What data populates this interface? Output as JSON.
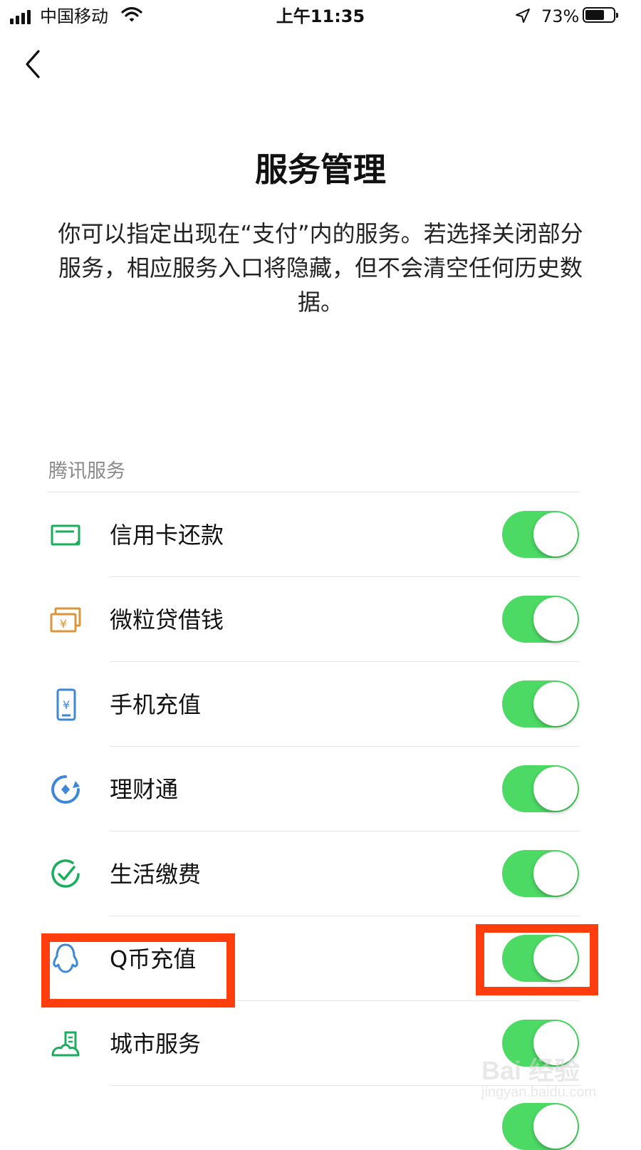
{
  "status_bar": {
    "carrier": "中国移动",
    "time": "上午11:35",
    "battery_percent": "73%",
    "battery_level": 0.73,
    "icons": [
      "signal-icon",
      "wifi-icon",
      "location-arrow-icon",
      "battery-icon"
    ]
  },
  "nav": {
    "back_icon": "chevron-left-icon"
  },
  "page": {
    "title": "服务管理",
    "description": "你可以指定出现在“支付”内的服务。若选择关闭部分服务，相应服务入口将隐藏，但不会清空任何历史数据。"
  },
  "section": {
    "label": "腾讯服务",
    "items": [
      {
        "label": "信用卡还款",
        "icon": "credit-card-icon",
        "enabled": true,
        "color": "#1aad5c"
      },
      {
        "label": "微粒贷借钱",
        "icon": "yuan-notes-icon",
        "enabled": true,
        "color": "#d9963a"
      },
      {
        "label": "手机充值",
        "icon": "phone-yuan-icon",
        "enabled": true,
        "color": "#3e87d6"
      },
      {
        "label": "理财通",
        "icon": "licaitong-icon",
        "enabled": true,
        "color": "#3e87d6"
      },
      {
        "label": "生活缴费",
        "icon": "check-circle-icon",
        "enabled": true,
        "color": "#1aad5c"
      },
      {
        "label": "Q币充值",
        "icon": "qq-penguin-icon",
        "enabled": true,
        "color": "#3e87d6"
      },
      {
        "label": "城市服务",
        "icon": "city-icon",
        "enabled": true,
        "color": "#1aad5c"
      }
    ]
  },
  "colors": {
    "toggle_on": "#4cd964",
    "highlight": "#ff3d0d",
    "section_label": "#8a8a8a"
  },
  "watermark": {
    "brand": "Bai 经验",
    "url": "jingyan.baidu.com"
  }
}
